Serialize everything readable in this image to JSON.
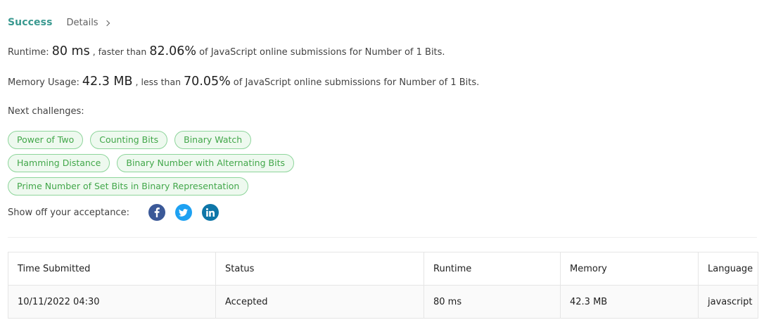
{
  "header": {
    "status": "Success",
    "details_label": "Details"
  },
  "runtime": {
    "label": "Runtime:",
    "value": "80 ms",
    "compare_text": ", faster than",
    "percent": "82.06%",
    "tail": "of JavaScript online submissions for Number of 1 Bits."
  },
  "memory": {
    "label": "Memory Usage:",
    "value": "42.3 MB",
    "compare_text": ", less than",
    "percent": "70.05%",
    "tail": "of JavaScript online submissions for Number of 1 Bits."
  },
  "next_challenges": {
    "label": "Next challenges:",
    "rows": [
      [
        "Power of Two",
        "Counting Bits",
        "Binary Watch"
      ],
      [
        "Hamming Distance",
        "Binary Number with Alternating Bits"
      ],
      [
        "Prime Number of Set Bits in Binary Representation"
      ]
    ]
  },
  "share": {
    "label": "Show off your acceptance:",
    "icons": [
      "facebook-icon",
      "twitter-icon",
      "linkedin-icon"
    ]
  },
  "table": {
    "headers": [
      "Time Submitted",
      "Status",
      "Runtime",
      "Memory",
      "Language"
    ],
    "rows": [
      [
        "10/11/2022 04:30",
        "Accepted",
        "80 ms",
        "42.3 MB",
        "javascript"
      ]
    ]
  },
  "colors": {
    "success": "#3a9990",
    "tag_border": "#8ed59b",
    "tag_bg": "#eef9ef",
    "tag_text": "#42a74a",
    "accepted": "#2e9c63"
  }
}
